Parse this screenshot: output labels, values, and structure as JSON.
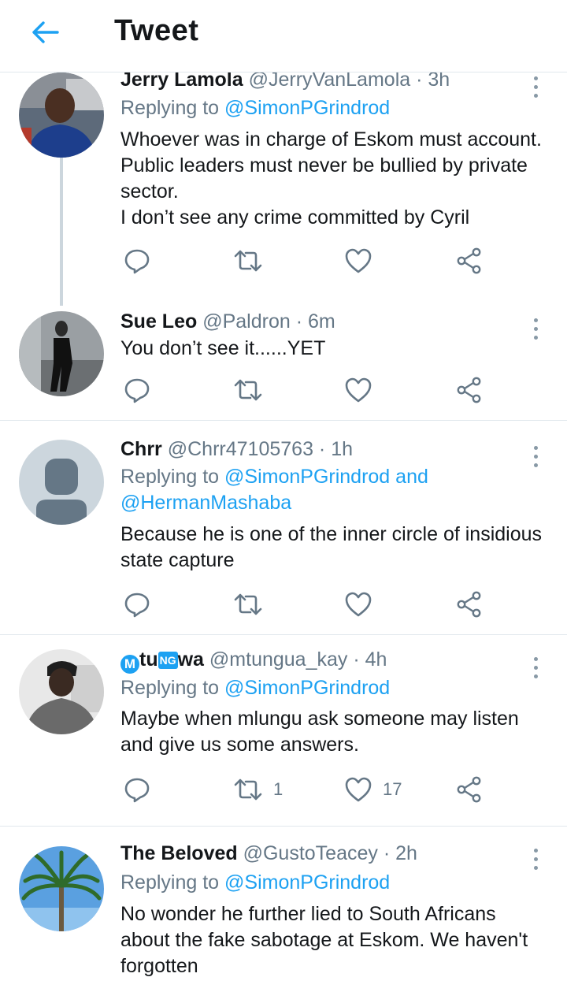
{
  "header": {
    "title": "Tweet"
  },
  "tweets": [
    {
      "name": "Jerry Lamola",
      "handle": "@JerryVanLamola",
      "time": "3h",
      "replying_prefix": "Replying to ",
      "replying_to": "@SimonPGrindrod",
      "replying_and": "",
      "replying_to2": "",
      "body": "Whoever was in charge of Eskom must account.\nPublic leaders must never be bullied by private sector.\nI don’t see any crime committed by Cyril"
    },
    {
      "name": "Sue Leo",
      "handle": "@Paldron",
      "time": "6m",
      "body": "You don’t see it......YET"
    },
    {
      "name": "Chrr",
      "handle": "@Chrr47105763",
      "time": "1h",
      "replying_prefix": "Replying to ",
      "replying_to": "@SimonPGrindrod",
      "replying_and": " and",
      "replying_to2": "@HermanMashaba",
      "body": "Because he is one of the inner circle of insidious state capture"
    },
    {
      "name_parts": [
        "M",
        "tu",
        "NG",
        "wa"
      ],
      "handle": "@mtungua_kay",
      "time": "4h",
      "replying_prefix": "Replying to ",
      "replying_to": "@SimonPGrindrod",
      "body": "Maybe when mlungu ask someone may listen and give us some answers.",
      "retweets": "1",
      "likes": "17"
    },
    {
      "name": "The Beloved",
      "handle": "@GustoTeacey",
      "time": "2h",
      "replying_prefix": "Replying to ",
      "replying_to": "@SimonPGrindrod",
      "body": "No wonder he further lied to South Africans about the fake sabotage at Eskom. We haven't forgotten"
    }
  ],
  "separator": " · ",
  "icons": {
    "back": "arrow-left-icon",
    "reply": "reply-icon",
    "retweet": "retweet-icon",
    "like": "heart-icon",
    "share": "share-icon",
    "more": "more-vertical-icon"
  },
  "colors": {
    "accent": "#1da1f2",
    "muted": "#657786",
    "text": "#14171a",
    "divider": "#e1e8ed"
  }
}
